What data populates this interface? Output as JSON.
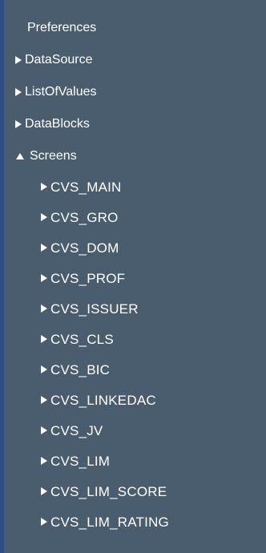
{
  "tree": {
    "preferences_label": "Preferences",
    "nodes": [
      {
        "label": "DataSource",
        "expanded": false
      },
      {
        "label": "ListOfValues",
        "expanded": false
      },
      {
        "label": "DataBlocks",
        "expanded": false
      },
      {
        "label": "Screens",
        "expanded": true
      }
    ],
    "screens_children": [
      "CVS_MAIN",
      "CVS_GRO",
      "CVS_DOM",
      "CVS_PROF",
      "CVS_ISSUER",
      "CVS_CLS",
      "CVS_BIC",
      "CVS_LINKEDAC",
      "CVS_JV",
      "CVS_LIM",
      "CVS_LIM_SCORE",
      "CVS_LIM_RATING"
    ],
    "icons": {
      "collapsed": "caret-right-icon",
      "expanded": "caret-up-icon"
    }
  },
  "colors": {
    "panel_background": "#4a5d6f",
    "left_accent": "#2c4f86",
    "text": "#ffffff"
  }
}
